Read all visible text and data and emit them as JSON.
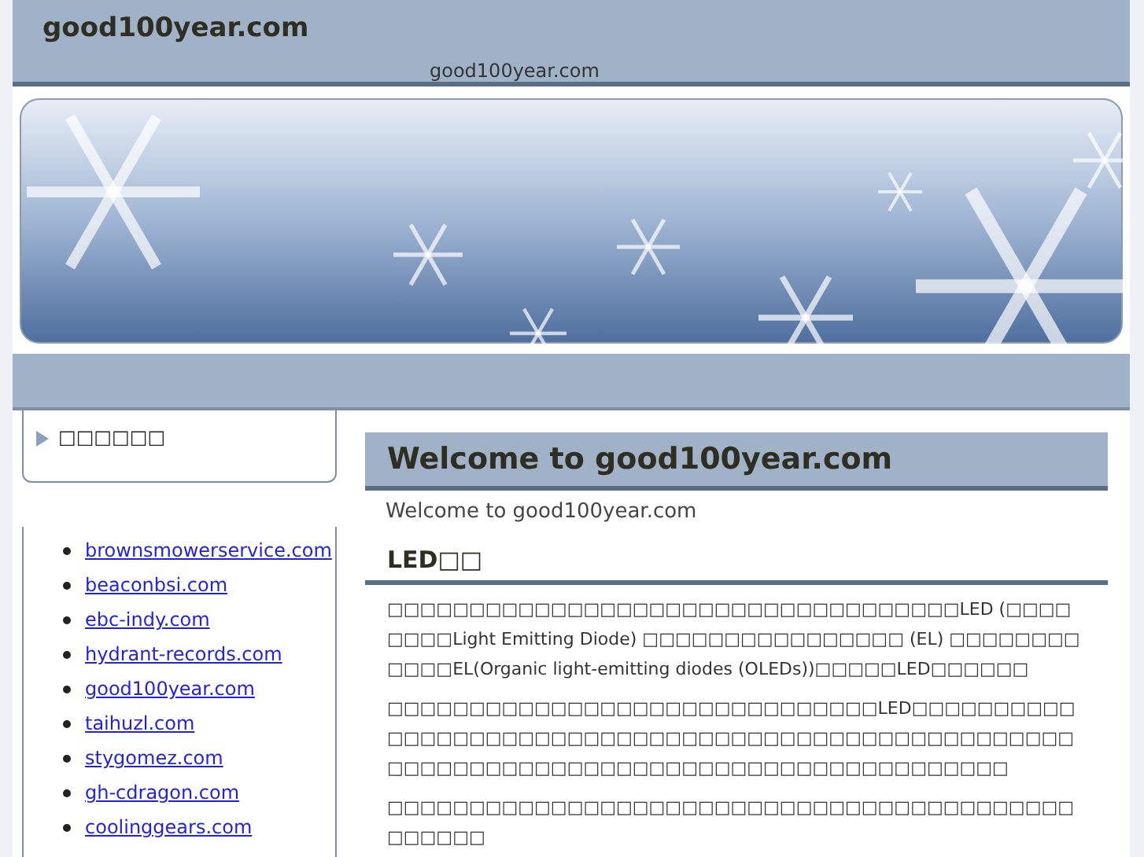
{
  "header": {
    "title": "good100year.com",
    "subtitle": "good100year.com"
  },
  "sidebar": {
    "menu_title": "□□□□□□",
    "links": [
      "brownsmowerservice.com",
      "beaconbsi.com",
      "ebc-indy.com",
      "hydrant-records.com",
      "good100year.com",
      "taihuzl.com",
      "stygomez.com",
      "gh-cdragon.com",
      "coolinggears.com"
    ]
  },
  "content": {
    "heading": "Welcome to good100year.com",
    "intro": "Welcome to good100year.com",
    "section_heading": "LED□□",
    "paragraphs": [
      "□□□□□□□□□□□□□□□□□□□□□□□□□□□□□□□□□□□LED (□□□□□□□□Light Emitting Diode) □□□□□□□□□□□□□□□□ (EL) □□□□□□□□□□□□EL(Organic light-emitting diodes (OLEDs))□□□□□LED□□□□□□",
      "□□□□□□□□□□□□□□□□□□□□□□□□□□□□□□LED□□□□□□□□□□□□□□□□□□□□□□□□□□□□□□□□□□□□□□□□□□□□□□□□□□□□□□□□□□□□□□□□□□□□□□□□□□□□□□□□□□□□□□□□□□",
      "□□□□□□□□□□□□□□□□□□□□□□□□□□□□□□□□□□□□□□□□□□□□□□□□"
    ]
  }
}
